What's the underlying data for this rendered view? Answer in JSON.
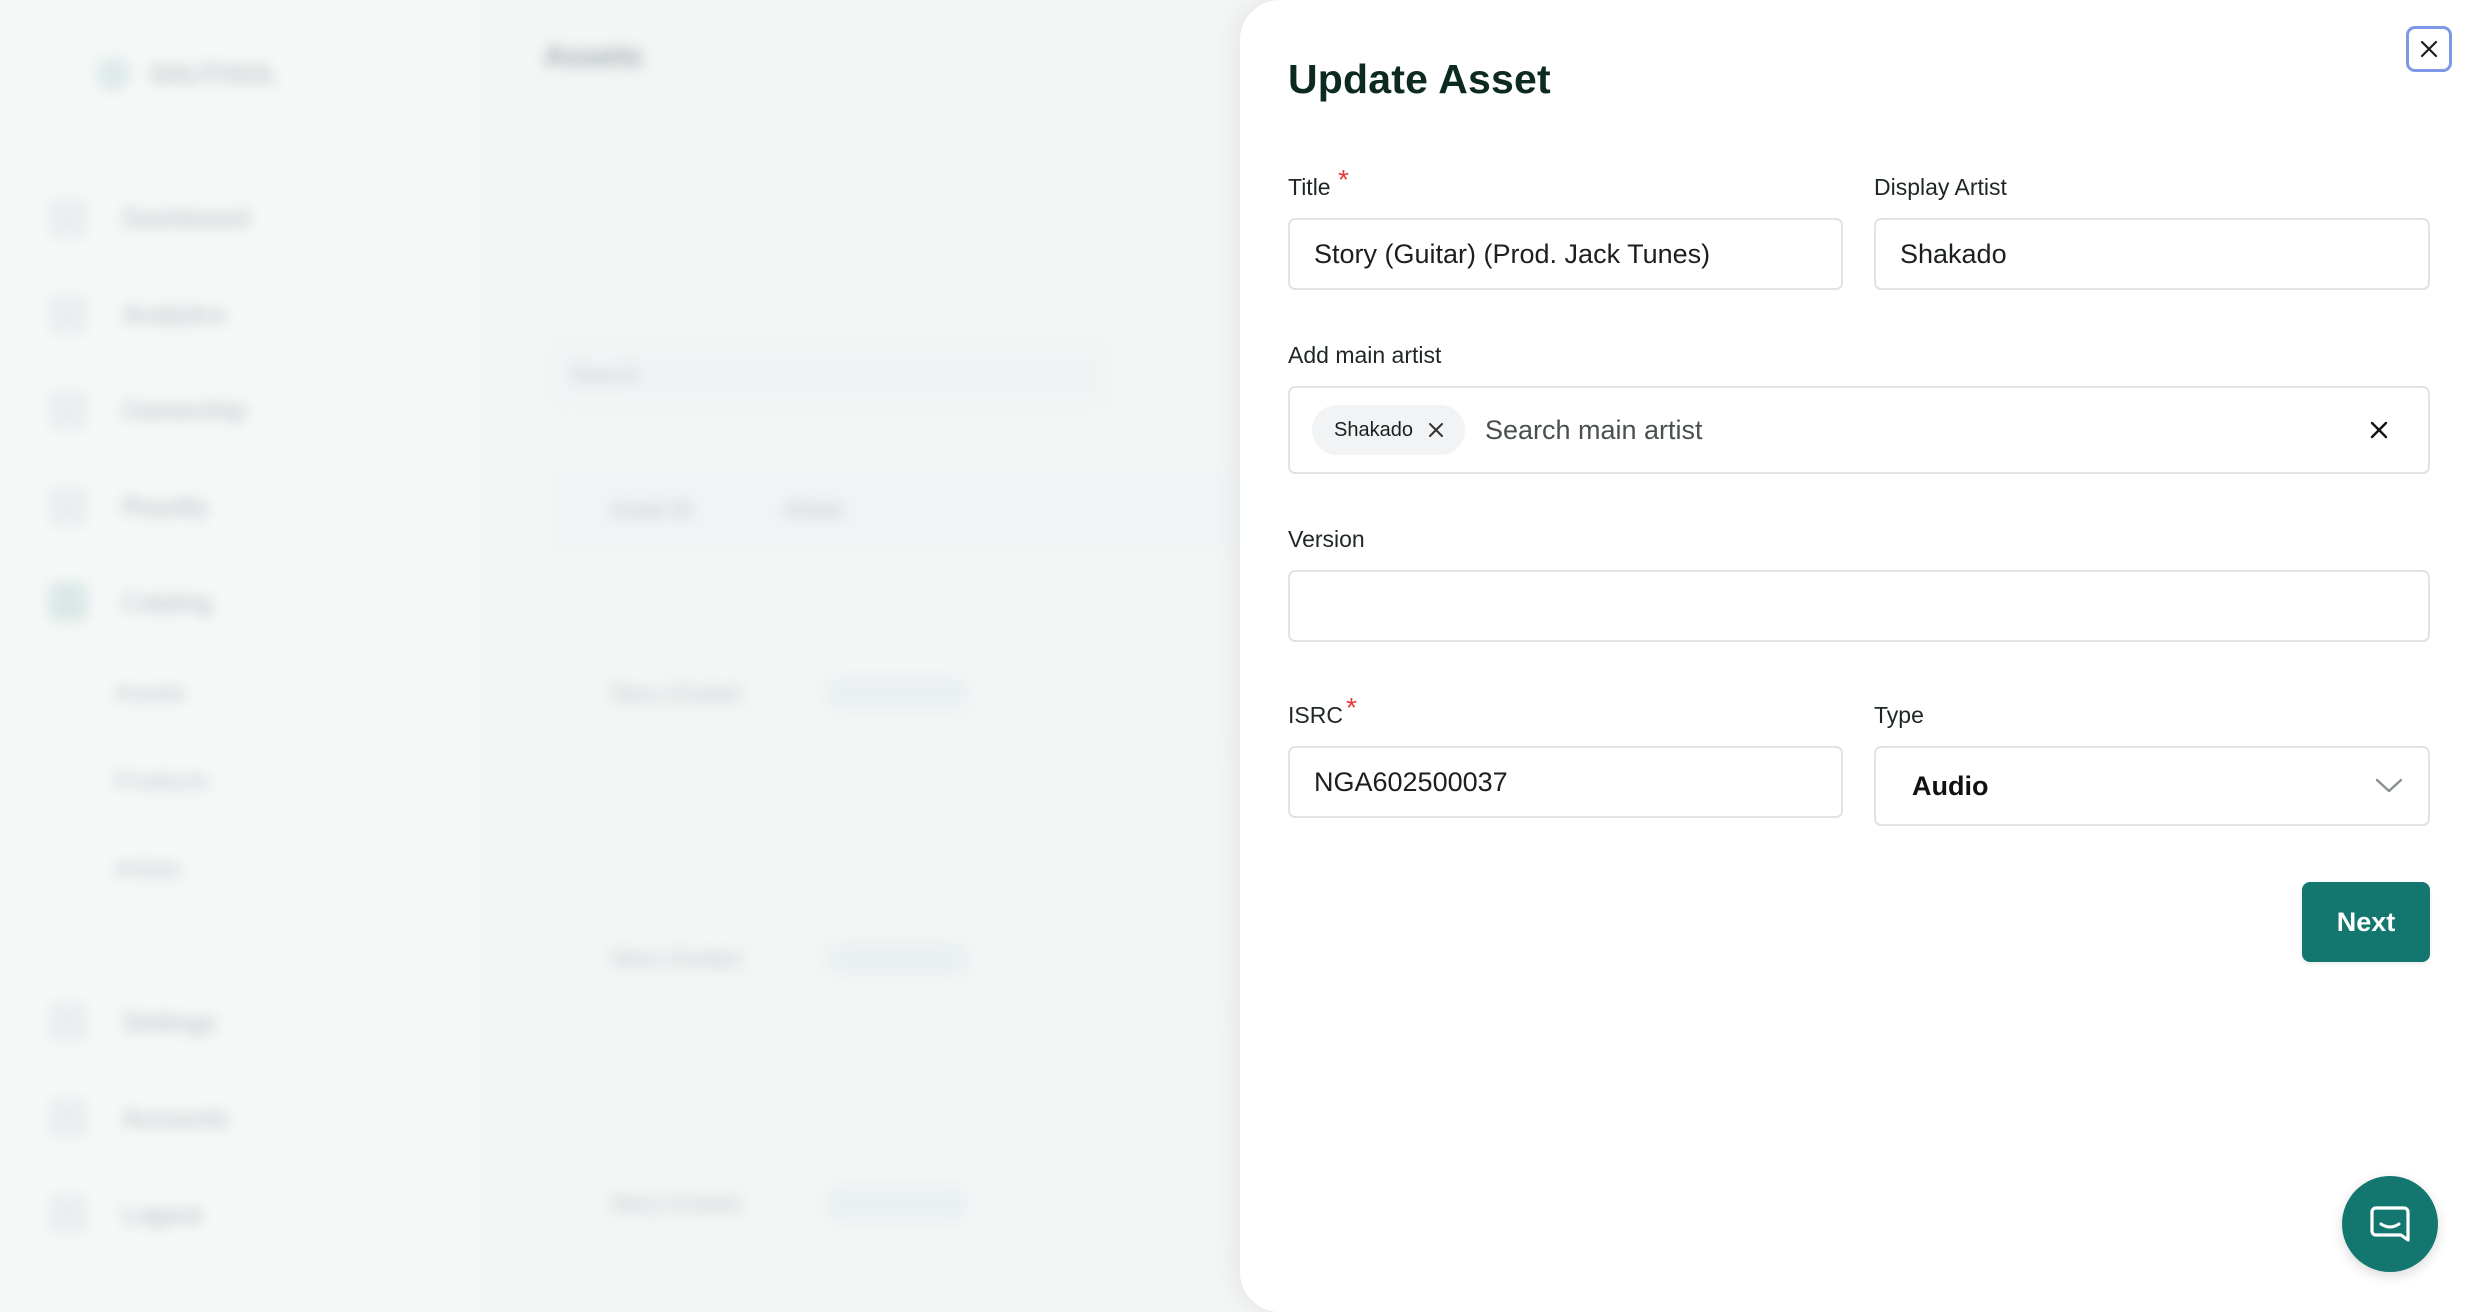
{
  "background": {
    "org_name": "SAUTISOL",
    "page_title": "Assets",
    "nav": [
      "Dashboard",
      "Analytics",
      "Ownership",
      "Royalty",
      "Catalog"
    ],
    "sub_nav": [
      "Assets",
      "Products",
      "Artists"
    ],
    "bottom_nav": [
      "Settings",
      "Accounts",
      "Logout"
    ],
    "search_placeholder": "Search",
    "table_headers": [
      "Asset ID",
      "Artists"
    ],
    "rows": [
      "Story (Guitar)",
      "Story (Guitar)",
      "Story (Guitar)"
    ]
  },
  "drawer": {
    "title": "Update Asset",
    "title_field": {
      "label": "Title",
      "required_mark": "*",
      "value": "Story (Guitar) (Prod. Jack Tunes)"
    },
    "display_artist": {
      "label": "Display Artist",
      "value": "Shakado"
    },
    "main_artist": {
      "label": "Add main artist",
      "chips": [
        "Shakado"
      ],
      "placeholder": "Search main artist"
    },
    "version": {
      "label": "Version",
      "value": ""
    },
    "isrc": {
      "label": "ISRC",
      "required_mark": "*",
      "value": "NGA602500037"
    },
    "type": {
      "label": "Type",
      "selected": "Audio"
    },
    "next_label": "Next"
  },
  "colors": {
    "primary": "#14776f",
    "title": "#0d2a1f",
    "required": "#e53935",
    "focus_ring": "#7d98e6"
  },
  "icons": {
    "close": "close-icon",
    "chip_remove": "x-icon",
    "clear": "x-icon",
    "dropdown": "chevron-down-icon",
    "chat": "chat-icon"
  }
}
